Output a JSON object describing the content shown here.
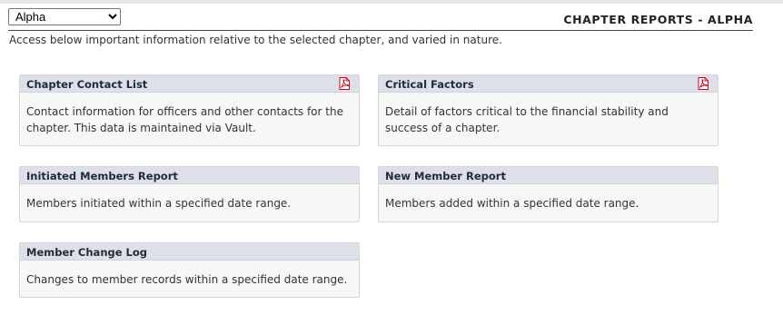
{
  "header": {
    "selected_chapter": "Alpha",
    "chapter_options": [
      "Alpha"
    ],
    "title": "CHAPTER REPORTS - ALPHA"
  },
  "intro": "Access below important information relative to the selected chapter, and varied in nature.",
  "cards": [
    {
      "title": "Chapter Contact List",
      "description": "Contact information for officers and other contacts for the chapter. This data is maintained via Vault.",
      "icon": "pdf-icon"
    },
    {
      "title": "Critical Factors",
      "description": "Detail of factors critical to the financial stability and success of a chapter.",
      "icon": "pdf-icon"
    },
    {
      "title": "Initiated Members Report",
      "description": "Members initiated within a specified date range."
    },
    {
      "title": "New Member Report",
      "description": "Members added within a specified date range."
    },
    {
      "title": "Member Change Log",
      "description": "Changes to member records within a specified date range."
    }
  ],
  "colors": {
    "card_header_bg": "#dde0e8",
    "card_body_bg": "#f6f8f6",
    "pdf_icon": "#d0021b"
  }
}
